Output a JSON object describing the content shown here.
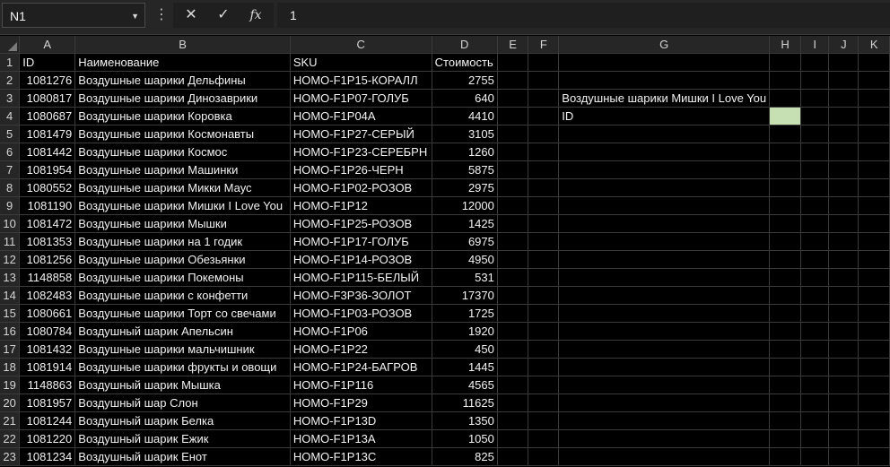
{
  "formula_bar": {
    "name_box": "N1",
    "cancel_icon": "close-icon",
    "enter_icon": "check-icon",
    "function_icon": "fx-icon",
    "function_label": "fx",
    "formula_value": "1"
  },
  "columns": [
    "A",
    "B",
    "C",
    "D",
    "E",
    "F",
    "G",
    "H",
    "I",
    "J",
    "K"
  ],
  "rows": [
    {
      "n": "1",
      "A": "ID",
      "B": "Наименование",
      "C": "SKU",
      "D": "Стоимость"
    },
    {
      "n": "2",
      "A": "1081276",
      "B": "Воздушные шарики Дельфины",
      "C": "HOMO-F1P15-КОРАЛЛ",
      "D": "2755"
    },
    {
      "n": "3",
      "A": "1080817",
      "B": "Воздушные шарики Динозаврики",
      "C": "HOMO-F1P07-ГОЛУБ",
      "D": "640",
      "G": "Воздушные шарики Мишки I Love You"
    },
    {
      "n": "4",
      "A": "1080687",
      "B": "Воздушные шарики Коровка",
      "C": "HOMO-F1P04A",
      "D": "4410",
      "G": "ID"
    },
    {
      "n": "5",
      "A": "1081479",
      "B": "Воздушные шарики Космонавты",
      "C": "HOMO-F1P27-СЕРЫЙ",
      "D": "3105"
    },
    {
      "n": "6",
      "A": "1081442",
      "B": "Воздушные шарики Космос",
      "C": "HOMO-F1P23-СЕРЕБРН",
      "D": "1260"
    },
    {
      "n": "7",
      "A": "1081954",
      "B": "Воздушные шарики Машинки",
      "C": "HOMO-F1P26-ЧЕРН",
      "D": "5875"
    },
    {
      "n": "8",
      "A": "1080552",
      "B": "Воздушные шарики Микки Маус",
      "C": "HOMO-F1P02-РОЗОВ",
      "D": "2975"
    },
    {
      "n": "9",
      "A": "1081190",
      "B": "Воздушные шарики Мишки I Love You",
      "C": "HOMO-F1P12",
      "D": "12000"
    },
    {
      "n": "10",
      "A": "1081472",
      "B": "Воздушные шарики Мышки",
      "C": "HOMO-F1P25-РОЗОВ",
      "D": "1425"
    },
    {
      "n": "11",
      "A": "1081353",
      "B": "Воздушные шарики на 1 годик",
      "C": "HOMO-F1P17-ГОЛУБ",
      "D": "6975"
    },
    {
      "n": "12",
      "A": "1081256",
      "B": "Воздушные шарики Обезьянки",
      "C": "HOMO-F1P14-РОЗОВ",
      "D": "4950"
    },
    {
      "n": "13",
      "A": "1148858",
      "B": "Воздушные шарики Покемоны",
      "C": "HOMO-F1P115-БЕЛЫЙ",
      "D": "531"
    },
    {
      "n": "14",
      "A": "1082483",
      "B": "Воздушные шарики с конфетти",
      "C": "HOMO-F3P36-ЗОЛОТ",
      "D": "17370"
    },
    {
      "n": "15",
      "A": "1080661",
      "B": "Воздушные шарики Торт со свечами",
      "C": "HOMO-F1P03-РОЗОВ",
      "D": "1725"
    },
    {
      "n": "16",
      "A": "1080784",
      "B": "Воздушный шарик Апельсин",
      "C": "HOMO-F1P06",
      "D": "1920"
    },
    {
      "n": "17",
      "A": "1081432",
      "B": "Воздушные шарики мальчишник",
      "C": "HOMO-F1P22",
      "D": "450"
    },
    {
      "n": "18",
      "A": "1081914",
      "B": "Воздушные шарики фрукты и овощи",
      "C": "HOMO-F1P24-БАГРОВ",
      "D": "1445"
    },
    {
      "n": "19",
      "A": "1148863",
      "B": "Воздушный шарик Мышка",
      "C": "HOMO-F1P116",
      "D": "4565"
    },
    {
      "n": "20",
      "A": "1081957",
      "B": "Воздушный шар Слон",
      "C": "HOMO-F1P29",
      "D": "11625"
    },
    {
      "n": "21",
      "A": "1081244",
      "B": "Воздушный шарик Белка",
      "C": "HOMO-F1P13D",
      "D": "1350"
    },
    {
      "n": "22",
      "A": "1081220",
      "B": "Воздушный шарик Ежик",
      "C": "HOMO-F1P13A",
      "D": "1050"
    },
    {
      "n": "23",
      "A": "1081234",
      "B": "Воздушный шарик Енот",
      "C": "HOMO-F1P13C",
      "D": "825"
    }
  ],
  "colors": {
    "highlight_cell": "#c6e0b4",
    "header_bg": "#262626",
    "cell_bg": "#000000"
  }
}
